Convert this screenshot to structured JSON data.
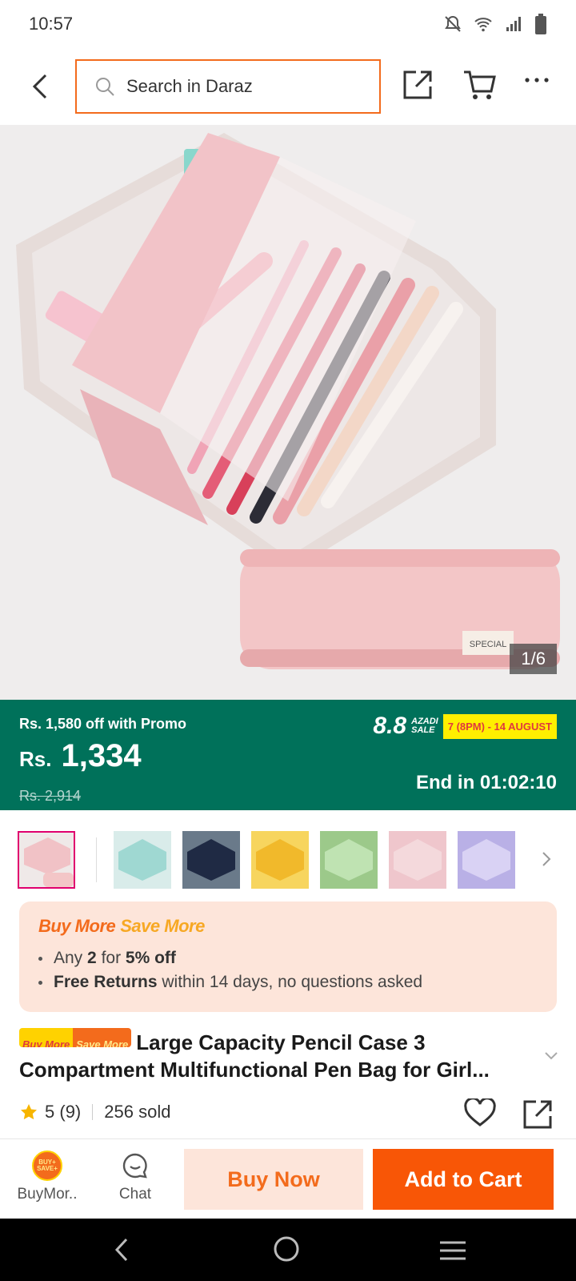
{
  "status": {
    "time": "10:57"
  },
  "search": {
    "placeholder": "Search in Daraz"
  },
  "gallery": {
    "counter": "1/6",
    "current": 1,
    "total": 6
  },
  "promo": {
    "discount_text": "Rs. 1,580 off with Promo",
    "currency": "Rs.",
    "price": "1,334",
    "original_price": "Rs. 2,914",
    "campaign_big": "8.8",
    "campaign_small_1": "AZADI",
    "campaign_small_2": "SALE",
    "campaign_dates": "7 (8PM) - 14 AUGUST",
    "ends_in": "End in 01:02:10"
  },
  "colors": {
    "accent": "#f85606",
    "promo_bg": "#00715a",
    "offer_bg": "#fde5da"
  },
  "offers": {
    "title_a": "Buy More",
    "title_b": "Save More",
    "items": [
      {
        "pre": "Any ",
        "bold1": "2",
        "mid": " for ",
        "bold2": "5% off"
      },
      {
        "bold": "Free Returns",
        "rest": " within 14 days, no questions asked"
      }
    ]
  },
  "product": {
    "badge_left": "Buy More",
    "badge_right": "Save More",
    "title": "Large Capacity Pencil Case 3 Compartment Multifunctional Pen Bag for Girl...",
    "rating": "5",
    "reviews": "(9)",
    "sold": "256 sold"
  },
  "bottom": {
    "buymore_label": "BuyMor..",
    "buymore_icon_text": "BUY+ SAVE+",
    "chat_label": "Chat",
    "buy_now": "Buy Now",
    "add_to_cart": "Add to Cart"
  }
}
